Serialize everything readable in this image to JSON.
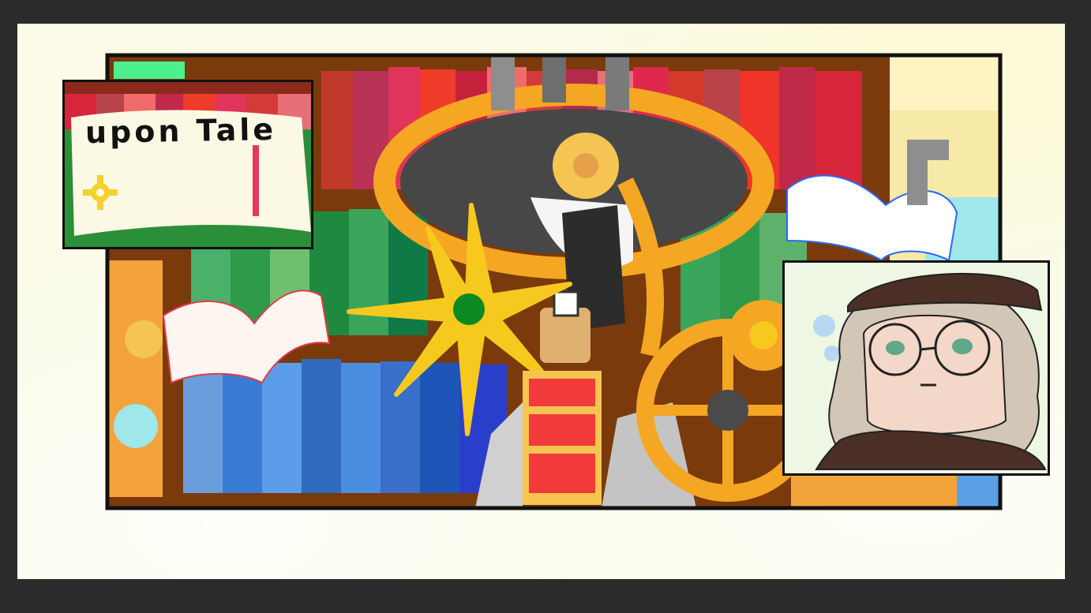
{
  "game": {
    "title_card_text": "upon Tale"
  },
  "panels": {
    "title_panel": "title-card",
    "main_panel": "library-gear-scene",
    "portrait_panel": "character-portrait"
  },
  "colors": {
    "background": "#2b2b2b",
    "paper": "#fbfbe8",
    "outline": "#111111",
    "gear_orange": "#f5a623",
    "star_yellow": "#f7c81e",
    "book_red": "#d6263a",
    "book_green": "#2e9a4a",
    "book_blue": "#3a7bd5",
    "shelf_brown": "#7a3a0c",
    "hat_brown": "#4b2e26",
    "hair": "#d2c6b7",
    "eyes": "#5fa88a"
  }
}
